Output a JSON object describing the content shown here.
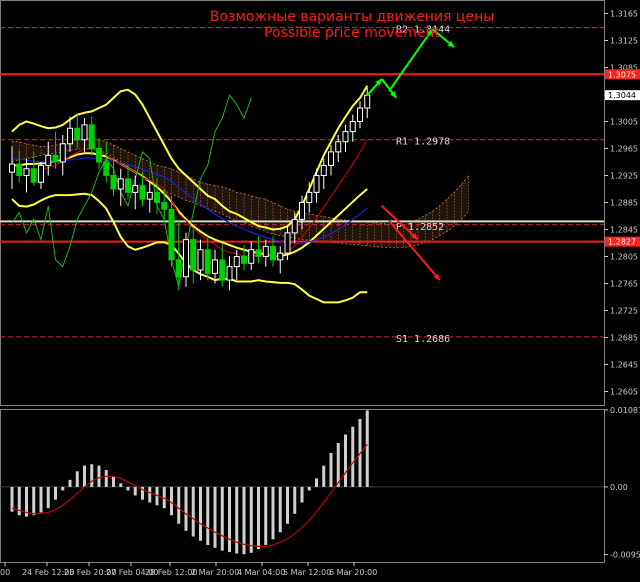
{
  "chart_data": [
    {
      "type": "candlestick",
      "title": "Возможные варианты движения цены",
      "subtitle": "Possible price movement",
      "ylim": [
        1.2585,
        1.3185
      ],
      "y_ticks": [
        "1.3165",
        "1.3125",
        "1.3085",
        "1.3044",
        "1.3005",
        "1.2965",
        "1.2925",
        "1.2885",
        "1.2845",
        "1.2805",
        "1.2765",
        "1.2725",
        "1.2685",
        "1.2645",
        "1.2605"
      ],
      "x_ticks": [
        "00",
        "24 Feb 12:00",
        "25 Feb 20:00",
        "27 Feb 04:00",
        "28 Feb 12:00",
        "2 Mar 20:00",
        "4 Mar 04:00",
        "5 Mar 12:00",
        "6 Mar 20:00"
      ],
      "price_badges": [
        {
          "label": "1.3075",
          "price": 1.3075,
          "color": "#ff2020"
        },
        {
          "label": "1.3044",
          "price": 1.3044,
          "color": "#ffffff",
          "text_color": "#000000"
        },
        {
          "label": "1.2827",
          "price": 1.2827,
          "color": "#ff2020"
        }
      ],
      "levels": [
        {
          "name": "R2",
          "value": "1.3144",
          "price": 1.3144,
          "style": "dashed",
          "color": "#d03030"
        },
        {
          "name": "R1",
          "value": "1.2978",
          "price": 1.2978,
          "style": "dashed",
          "color": "#d03030"
        },
        {
          "name": "P",
          "value": "1.2852",
          "price": 1.2852,
          "style": "dashed",
          "color": "#d03030"
        },
        {
          "name": "S1",
          "value": "1.2686",
          "price": 1.2686,
          "style": "dashed",
          "color": "#d03030"
        },
        {
          "name": "",
          "value": "",
          "price": 1.3075,
          "style": "solid",
          "color": "#ff1a1a"
        },
        {
          "name": "",
          "value": "",
          "price": 1.2827,
          "style": "solid",
          "color": "#ff1a1a"
        },
        {
          "name": "",
          "value": "",
          "price": 1.2857,
          "style": "solid",
          "color": "#d8d8c0"
        }
      ],
      "colors": {
        "bull": "#ffffff",
        "bear": "#00d000",
        "bands": "#ffff40",
        "fast_ma": "#c00000",
        "slow_ma": "#2020d0",
        "rsi": "#20c020",
        "cloud": "#c87850",
        "arrow_up": "#00ff00",
        "arrow_down": "#ff1a1a"
      },
      "candles": [
        {
          "o": 1.293,
          "h": 1.2968,
          "l": 1.2905,
          "c": 1.2942
        },
        {
          "o": 1.2942,
          "h": 1.2962,
          "l": 1.2915,
          "c": 1.2925
        },
        {
          "o": 1.2925,
          "h": 1.295,
          "l": 1.29,
          "c": 1.2935
        },
        {
          "o": 1.2935,
          "h": 1.296,
          "l": 1.291,
          "c": 1.2915
        },
        {
          "o": 1.2915,
          "h": 1.2945,
          "l": 1.2905,
          "c": 1.294
        },
        {
          "o": 1.294,
          "h": 1.2975,
          "l": 1.2925,
          "c": 1.2955
        },
        {
          "o": 1.2955,
          "h": 1.299,
          "l": 1.2935,
          "c": 1.2945
        },
        {
          "o": 1.2945,
          "h": 1.2985,
          "l": 1.2925,
          "c": 1.2972
        },
        {
          "o": 1.2972,
          "h": 1.3012,
          "l": 1.296,
          "c": 1.2995
        },
        {
          "o": 1.2995,
          "h": 1.3015,
          "l": 1.2965,
          "c": 1.2978
        },
        {
          "o": 1.2978,
          "h": 1.301,
          "l": 1.296,
          "c": 1.3
        },
        {
          "o": 1.3,
          "h": 1.3012,
          "l": 1.2955,
          "c": 1.2965
        },
        {
          "o": 1.2965,
          "h": 1.298,
          "l": 1.2935,
          "c": 1.2945
        },
        {
          "o": 1.2945,
          "h": 1.2975,
          "l": 1.2915,
          "c": 1.2925
        },
        {
          "o": 1.2925,
          "h": 1.295,
          "l": 1.2895,
          "c": 1.2905
        },
        {
          "o": 1.2905,
          "h": 1.2935,
          "l": 1.288,
          "c": 1.292
        },
        {
          "o": 1.292,
          "h": 1.294,
          "l": 1.289,
          "c": 1.29
        },
        {
          "o": 1.29,
          "h": 1.2925,
          "l": 1.2875,
          "c": 1.291
        },
        {
          "o": 1.291,
          "h": 1.293,
          "l": 1.288,
          "c": 1.289
        },
        {
          "o": 1.289,
          "h": 1.2915,
          "l": 1.287,
          "c": 1.29
        },
        {
          "o": 1.29,
          "h": 1.292,
          "l": 1.2868,
          "c": 1.2885
        },
        {
          "o": 1.2885,
          "h": 1.2905,
          "l": 1.2855,
          "c": 1.2875
        },
        {
          "o": 1.2875,
          "h": 1.2895,
          "l": 1.279,
          "c": 1.28
        },
        {
          "o": 1.28,
          "h": 1.286,
          "l": 1.2755,
          "c": 1.2775
        },
        {
          "o": 1.2775,
          "h": 1.284,
          "l": 1.276,
          "c": 1.283
        },
        {
          "o": 1.283,
          "h": 1.2845,
          "l": 1.2765,
          "c": 1.2785
        },
        {
          "o": 1.2785,
          "h": 1.283,
          "l": 1.277,
          "c": 1.2815
        },
        {
          "o": 1.2815,
          "h": 1.2835,
          "l": 1.277,
          "c": 1.278
        },
        {
          "o": 1.278,
          "h": 1.2815,
          "l": 1.2765,
          "c": 1.28
        },
        {
          "o": 1.28,
          "h": 1.2825,
          "l": 1.276,
          "c": 1.277
        },
        {
          "o": 1.277,
          "h": 1.2805,
          "l": 1.2755,
          "c": 1.279
        },
        {
          "o": 1.279,
          "h": 1.2815,
          "l": 1.277,
          "c": 1.2805
        },
        {
          "o": 1.2805,
          "h": 1.2822,
          "l": 1.2785,
          "c": 1.2795
        },
        {
          "o": 1.2795,
          "h": 1.2828,
          "l": 1.2785,
          "c": 1.2815
        },
        {
          "o": 1.2815,
          "h": 1.2835,
          "l": 1.2795,
          "c": 1.2805
        },
        {
          "o": 1.2805,
          "h": 1.283,
          "l": 1.279,
          "c": 1.282
        },
        {
          "o": 1.282,
          "h": 1.2835,
          "l": 1.279,
          "c": 1.28
        },
        {
          "o": 1.28,
          "h": 1.282,
          "l": 1.278,
          "c": 1.281
        },
        {
          "o": 1.281,
          "h": 1.285,
          "l": 1.28,
          "c": 1.284
        },
        {
          "o": 1.284,
          "h": 1.287,
          "l": 1.2825,
          "c": 1.286
        },
        {
          "o": 1.286,
          "h": 1.2895,
          "l": 1.2845,
          "c": 1.2885
        },
        {
          "o": 1.2885,
          "h": 1.2915,
          "l": 1.287,
          "c": 1.29
        },
        {
          "o": 1.29,
          "h": 1.2935,
          "l": 1.2885,
          "c": 1.2925
        },
        {
          "o": 1.2925,
          "h": 1.295,
          "l": 1.2905,
          "c": 1.294
        },
        {
          "o": 1.294,
          "h": 1.297,
          "l": 1.2925,
          "c": 1.296
        },
        {
          "o": 1.296,
          "h": 1.2985,
          "l": 1.2945,
          "c": 1.2975
        },
        {
          "o": 1.2975,
          "h": 1.3,
          "l": 1.296,
          "c": 1.299
        },
        {
          "o": 1.299,
          "h": 1.3015,
          "l": 1.2975,
          "c": 1.3005
        },
        {
          "o": 1.3005,
          "h": 1.3035,
          "l": 1.2995,
          "c": 1.3025
        },
        {
          "o": 1.3025,
          "h": 1.3055,
          "l": 1.301,
          "c": 1.3044
        }
      ],
      "bands_upper": [
        1.299,
        1.3,
        1.3005,
        1.3002,
        1.2998,
        1.2995,
        1.2996,
        1.3,
        1.3008,
        1.3015,
        1.3018,
        1.302,
        1.3025,
        1.303,
        1.304,
        1.305,
        1.3052,
        1.3045,
        1.303,
        1.301,
        1.299,
        1.297,
        1.295,
        1.2935,
        1.2925,
        1.2915,
        1.2905,
        1.2895,
        1.289,
        1.288,
        1.2872,
        1.2868,
        1.2862,
        1.2856,
        1.285,
        1.2848,
        1.2845,
        1.2846,
        1.285,
        1.286,
        1.288,
        1.2905,
        1.293,
        1.2955,
        1.2975,
        1.2995,
        1.3012,
        1.3028,
        1.304,
        1.3058
      ],
      "bands_mid": [
        1.294,
        1.294,
        1.2942,
        1.2942,
        1.2943,
        1.2944,
        1.2946,
        1.2948,
        1.2952,
        1.2956,
        1.2958,
        1.2958,
        1.2956,
        1.2953,
        1.2948,
        1.2942,
        1.2936,
        1.293,
        1.2924,
        1.2916,
        1.2908,
        1.2898,
        1.2886,
        1.2872,
        1.286,
        1.285,
        1.2842,
        1.2835,
        1.283,
        1.2826,
        1.2822,
        1.2818,
        1.2815,
        1.2812,
        1.281,
        1.2808,
        1.2806,
        1.2806,
        1.2808,
        1.2812,
        1.2818,
        1.2826,
        1.2836,
        1.2846,
        1.2856,
        1.2866,
        1.2876,
        1.2886,
        1.2896,
        1.2905
      ],
      "bands_lower": [
        1.289,
        1.288,
        1.2879,
        1.2882,
        1.2888,
        1.2893,
        1.2896,
        1.2896,
        1.2896,
        1.2897,
        1.2898,
        1.2896,
        1.2887,
        1.2876,
        1.2856,
        1.2834,
        1.282,
        1.2815,
        1.2818,
        1.2822,
        1.2826,
        1.2826,
        1.2822,
        1.2809,
        1.2795,
        1.2785,
        1.2779,
        1.2775,
        1.277,
        1.2772,
        1.2772,
        1.2768,
        1.2768,
        1.2768,
        1.277,
        1.2768,
        1.2767,
        1.2766,
        1.2766,
        1.2764,
        1.2756,
        1.2747,
        1.2742,
        1.2737,
        1.2737,
        1.2737,
        1.274,
        1.2744,
        1.2752,
        1.2752
      ],
      "fast_ma": [
        1.2935,
        1.2934,
        1.2934,
        1.2931,
        1.2933,
        1.2937,
        1.294,
        1.2946,
        1.2954,
        1.2959,
        1.2964,
        1.2964,
        1.2961,
        1.2955,
        1.2947,
        1.2942,
        1.2936,
        1.293,
        1.2922,
        1.2918,
        1.2912,
        1.2906,
        1.2888,
        1.2868,
        1.2858,
        1.2846,
        1.2838,
        1.2828,
        1.2823,
        1.2815,
        1.2811,
        1.2809,
        1.2806,
        1.2807,
        1.2806,
        1.2808,
        1.2806,
        1.2806,
        1.2812,
        1.2821,
        1.2834,
        1.2847,
        1.2862,
        1.2878,
        1.2894,
        1.291,
        1.2926,
        1.2942,
        1.296,
        1.2978
      ],
      "slow_ma": [
        1.295,
        1.2949,
        1.2948,
        1.2946,
        1.2945,
        1.2945,
        1.2945,
        1.2946,
        1.2948,
        1.2949,
        1.2951,
        1.2951,
        1.295,
        1.2948,
        1.2946,
        1.2944,
        1.2941,
        1.2938,
        1.2934,
        1.2931,
        1.2927,
        1.2923,
        1.2916,
        1.2907,
        1.2899,
        1.2891,
        1.2883,
        1.2875,
        1.2868,
        1.2861,
        1.2855,
        1.285,
        1.2845,
        1.2841,
        1.2837,
        1.2833,
        1.283,
        1.2827,
        1.2825,
        1.2824,
        1.2825,
        1.2827,
        1.283,
        1.2834,
        1.2839,
        1.2845,
        1.2852,
        1.286,
        1.2868,
        1.2877
      ],
      "cloud_upper": [
        1.2975,
        1.2975,
        1.2972,
        1.297,
        1.2968,
        1.2968,
        1.297,
        1.2972,
        1.2975,
        1.2978,
        1.298,
        1.298,
        1.2978,
        1.2975,
        1.297,
        1.2965,
        1.296,
        1.2955,
        1.295,
        1.2945,
        1.294,
        1.2938,
        1.2935,
        1.293,
        1.2925,
        1.292,
        1.2915,
        1.2912,
        1.291,
        1.2908,
        1.2905,
        1.29,
        1.2898,
        1.2895,
        1.2892,
        1.289,
        1.2885,
        1.288,
        1.2875,
        1.2872,
        1.287,
        1.2868,
        1.2866,
        1.2864,
        1.2862,
        1.286,
        1.2859,
        1.2858,
        1.2857,
        1.2856,
        1.2855,
        1.2854,
        1.2853,
        1.2852,
        1.2852,
        1.2855,
        1.286,
        1.2866,
        1.2872,
        1.288,
        1.289,
        1.29,
        1.2912,
        1.2925
      ],
      "cloud_lower": [
        1.2945,
        1.2948,
        1.295,
        1.2952,
        1.2955,
        1.2957,
        1.2958,
        1.296,
        1.2962,
        1.2964,
        1.2965,
        1.2965,
        1.2962,
        1.2958,
        1.2952,
        1.2945,
        1.2938,
        1.293,
        1.2922,
        1.2915,
        1.2908,
        1.2902,
        1.2898,
        1.2893,
        1.2888,
        1.2885,
        1.288,
        1.2876,
        1.2872,
        1.2868,
        1.2862,
        1.2858,
        1.2855,
        1.285,
        1.2846,
        1.2842,
        1.2838,
        1.2836,
        1.2834,
        1.2832,
        1.283,
        1.2829,
        1.2828,
        1.2827,
        1.2826,
        1.2825,
        1.2824,
        1.2823,
        1.2822,
        1.2821,
        1.282,
        1.2819,
        1.2818,
        1.2818,
        1.2818,
        1.282,
        1.2822,
        1.2826,
        1.283,
        1.2836,
        1.2842,
        1.285,
        1.286,
        1.2872
      ],
      "rsi_line": [
        1.2855,
        1.287,
        1.284,
        1.286,
        1.283,
        1.288,
        1.28,
        1.279,
        1.282,
        1.286,
        1.288,
        1.29,
        1.293,
        1.295,
        1.2935,
        1.29,
        1.288,
        1.292,
        1.296,
        1.295,
        1.288,
        1.286,
        1.28,
        1.276,
        1.282,
        1.287,
        1.292,
        1.294,
        1.299,
        1.301,
        1.3044,
        1.303,
        1.301,
        1.304
      ],
      "arrows": [
        {
          "dir": "up",
          "points": [
            [
              49,
              1.3044
            ],
            [
              51,
              1.3068
            ]
          ]
        },
        {
          "dir": "up",
          "points": [
            [
              51,
              1.3068
            ],
            [
              53,
              1.304
            ]
          ]
        },
        {
          "dir": "up",
          "points": [
            [
              52,
              1.305
            ],
            [
              58,
              1.3142
            ]
          ]
        },
        {
          "dir": "up",
          "points": [
            [
              58,
              1.3142
            ],
            [
              61,
              1.3115
            ]
          ]
        },
        {
          "dir": "down",
          "points": [
            [
              51,
              1.288
            ],
            [
              56,
              1.283
            ]
          ]
        },
        {
          "dir": "down",
          "points": [
            [
              52,
              1.2858
            ],
            [
              59,
              1.277
            ]
          ]
        }
      ]
    },
    {
      "type": "bar",
      "title": "",
      "ylim": [
        -0.0106,
        0.011
      ],
      "y_ticks": [
        "0.01087",
        "0.00",
        "-0.00955"
      ],
      "values": [
        -0.0035,
        -0.004,
        -0.0042,
        -0.004,
        -0.0036,
        -0.003,
        -0.0018,
        -0.0005,
        0.001,
        0.0022,
        0.003,
        0.0032,
        0.003,
        0.0024,
        0.0015,
        0.0005,
        -0.0005,
        -0.0012,
        -0.0018,
        -0.0022,
        -0.0026,
        -0.003,
        -0.004,
        -0.0052,
        -0.0062,
        -0.007,
        -0.0076,
        -0.0082,
        -0.0086,
        -0.009,
        -0.0092,
        -0.0094,
        -0.0095,
        -0.0093,
        -0.0088,
        -0.0082,
        -0.0074,
        -0.0064,
        -0.0052,
        -0.0038,
        -0.0022,
        -0.0005,
        0.0012,
        0.003,
        0.0048,
        0.0062,
        0.0074,
        0.0085,
        0.0096,
        0.0108
      ],
      "signal": [
        -0.003,
        -0.0033,
        -0.0036,
        -0.0038,
        -0.0037,
        -0.0036,
        -0.0032,
        -0.0026,
        -0.0018,
        -0.0009,
        0.0,
        0.0008,
        0.0013,
        0.0015,
        0.0015,
        0.0012,
        0.0007,
        0.0002,
        -0.0004,
        -0.0008,
        -0.0012,
        -0.0016,
        -0.0022,
        -0.003,
        -0.0038,
        -0.0045,
        -0.0052,
        -0.0058,
        -0.0064,
        -0.0069,
        -0.0074,
        -0.0078,
        -0.0081,
        -0.0083,
        -0.0084,
        -0.0084,
        -0.0082,
        -0.0078,
        -0.0073,
        -0.0066,
        -0.0057,
        -0.0047,
        -0.0035,
        -0.0022,
        -0.0008,
        0.0006,
        0.002,
        0.0034,
        0.0047,
        0.006
      ],
      "colors": {
        "bar": "#d0d0d0",
        "signal": "#c00000"
      }
    }
  ]
}
